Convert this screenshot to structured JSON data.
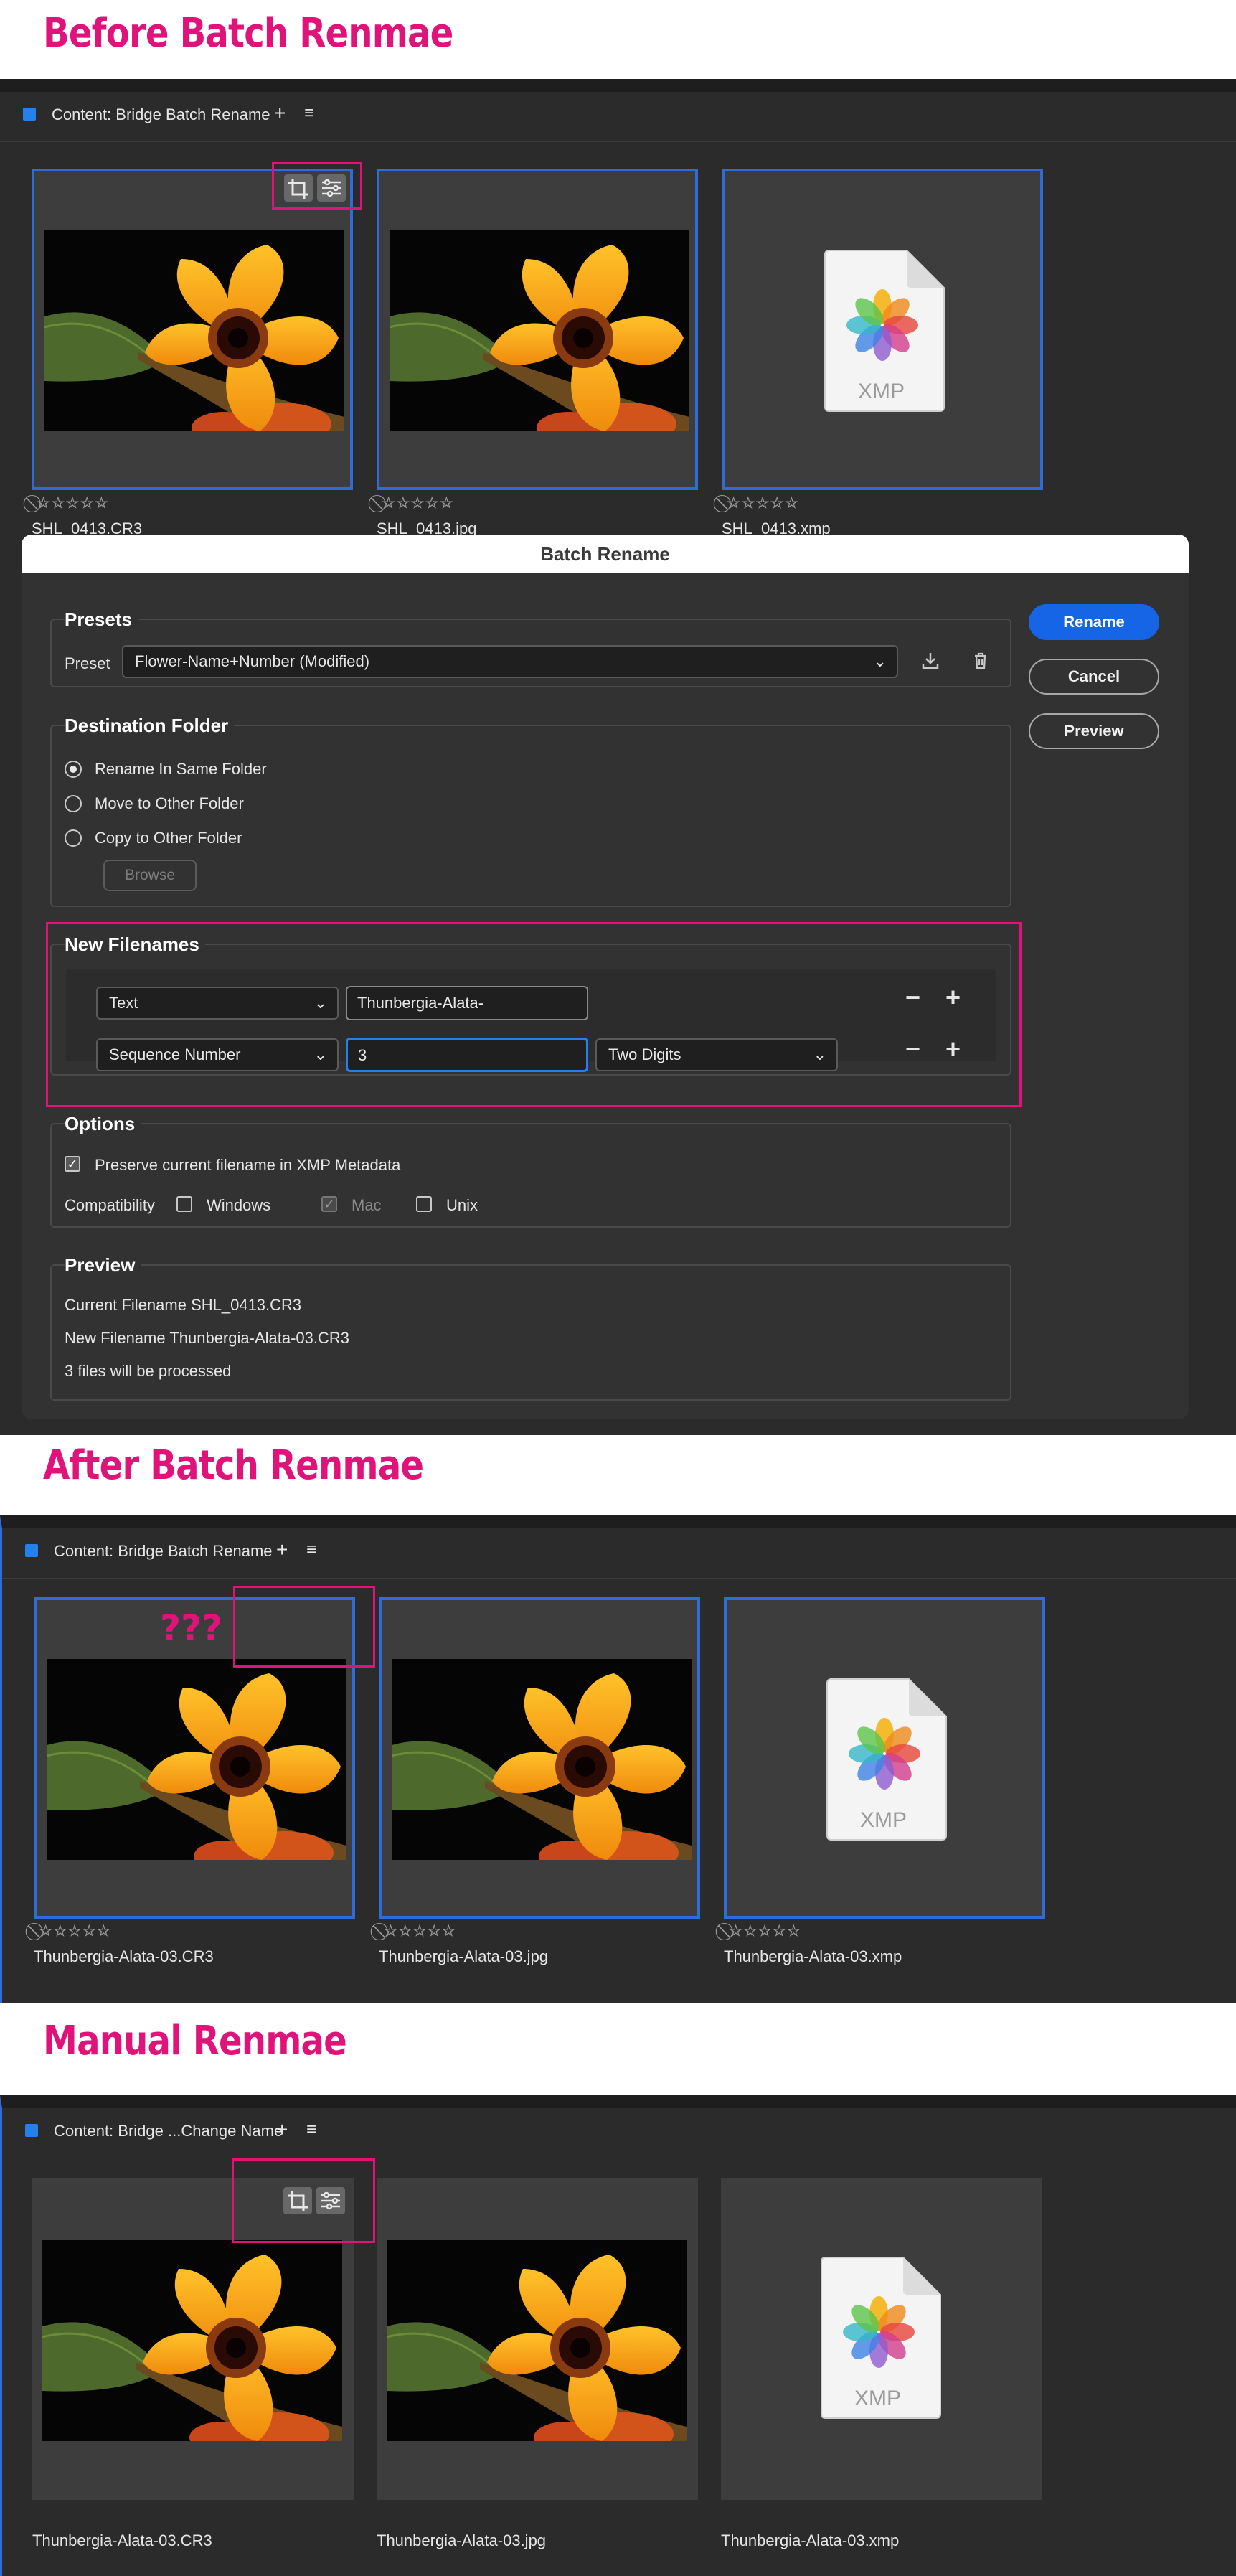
{
  "headings": {
    "before": "Before Batch Renmae",
    "after": "After Batch Renmae",
    "manual": "Manual Renmae"
  },
  "panels": {
    "before": {
      "tab_title": "Content: Bridge Batch Rename",
      "files": [
        "SHL_0413.CR3",
        "SHL_0413.jpg",
        "SHL_0413.xmp"
      ]
    },
    "after": {
      "tab_title": "Content: Bridge Batch Rename",
      "files": [
        "Thunbergia-Alata-03.CR3",
        "Thunbergia-Alata-03.jpg",
        "Thunbergia-Alata-03.xmp"
      ],
      "annotation": "???"
    },
    "manual": {
      "tab_title": "Content: Bridge ...Change Name",
      "files": [
        "Thunbergia-Alata-03.CR3",
        "Thunbergia-Alata-03.jpg",
        "Thunbergia-Alata-03.xmp"
      ]
    }
  },
  "tab_plus": "+",
  "tab_menu": "≡",
  "stars": "⃠☆☆☆☆☆",
  "xmp_label": "XMP",
  "dialog": {
    "title": "Batch Rename",
    "presets": {
      "title": "Presets",
      "label": "Preset",
      "value": "Flower-Name+Number (Modified)"
    },
    "destination": {
      "title": "Destination Folder",
      "options": [
        "Rename In Same Folder",
        "Move to Other Folder",
        "Copy to Other Folder"
      ],
      "browse": "Browse"
    },
    "new_filenames": {
      "title": "New Filenames",
      "row1": {
        "type": "Text",
        "value": "Thunbergia-Alata-"
      },
      "row2": {
        "type": "Sequence Number",
        "value": "3",
        "digits": "Two Digits"
      }
    },
    "options": {
      "title": "Options",
      "preserve": "Preserve current filename in XMP Metadata",
      "compat_label": "Compatibility",
      "windows": "Windows",
      "mac": "Mac",
      "unix": "Unix"
    },
    "preview": {
      "title": "Preview",
      "current": "Current Filename SHL_0413.CR3",
      "new": "New Filename Thunbergia-Alata-03.CR3",
      "count": "3 files will be processed"
    },
    "buttons": {
      "rename": "Rename",
      "cancel": "Cancel",
      "preview": "Preview"
    }
  },
  "colors": {
    "accent": "#e0137a",
    "selection": "#2f6bd9",
    "primary_button": "#1565e6"
  }
}
